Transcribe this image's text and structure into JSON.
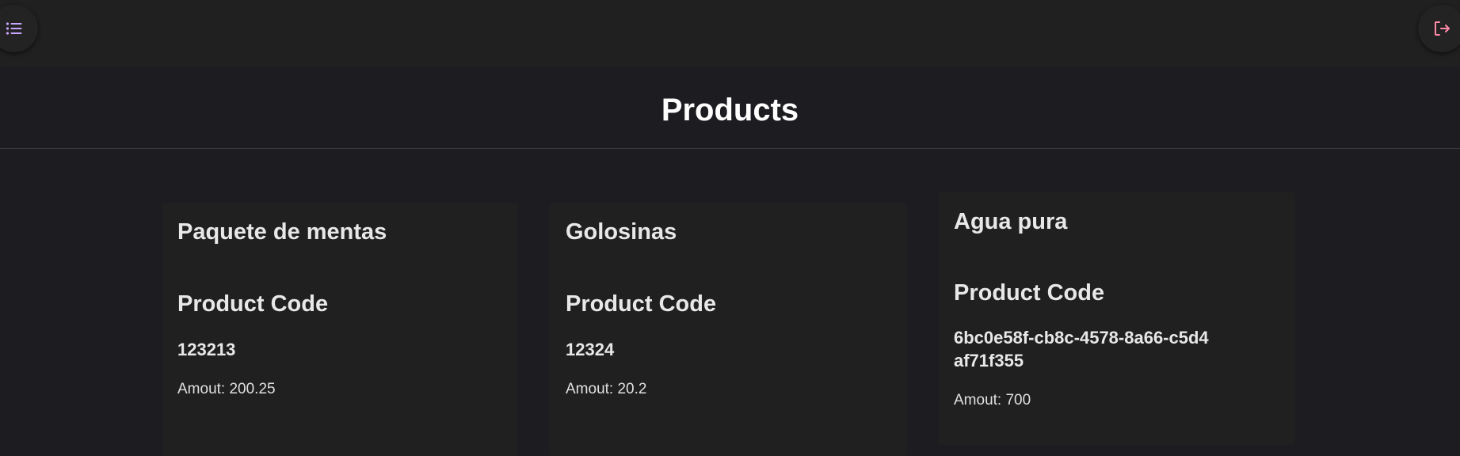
{
  "topbar": {
    "menu_icon": "list-icon",
    "logout_icon": "logout-icon",
    "accent_menu": "#b9a3ff",
    "accent_logout": "#ff8aa8"
  },
  "header": {
    "title": "Products"
  },
  "products": [
    {
      "name": "Paquete de mentas",
      "code_label": "Product Code",
      "code": "123213",
      "amount": "Amout: 200.25"
    },
    {
      "name": "Golosinas",
      "code_label": "Product Code",
      "code": "12324",
      "amount": "Amout: 20.2"
    },
    {
      "name": "Agua pura",
      "code_label": "Product Code",
      "code": "6bc0e58f-cb8c-4578-8a66-c5d4af71f355",
      "amount": "Amout: 700"
    }
  ]
}
